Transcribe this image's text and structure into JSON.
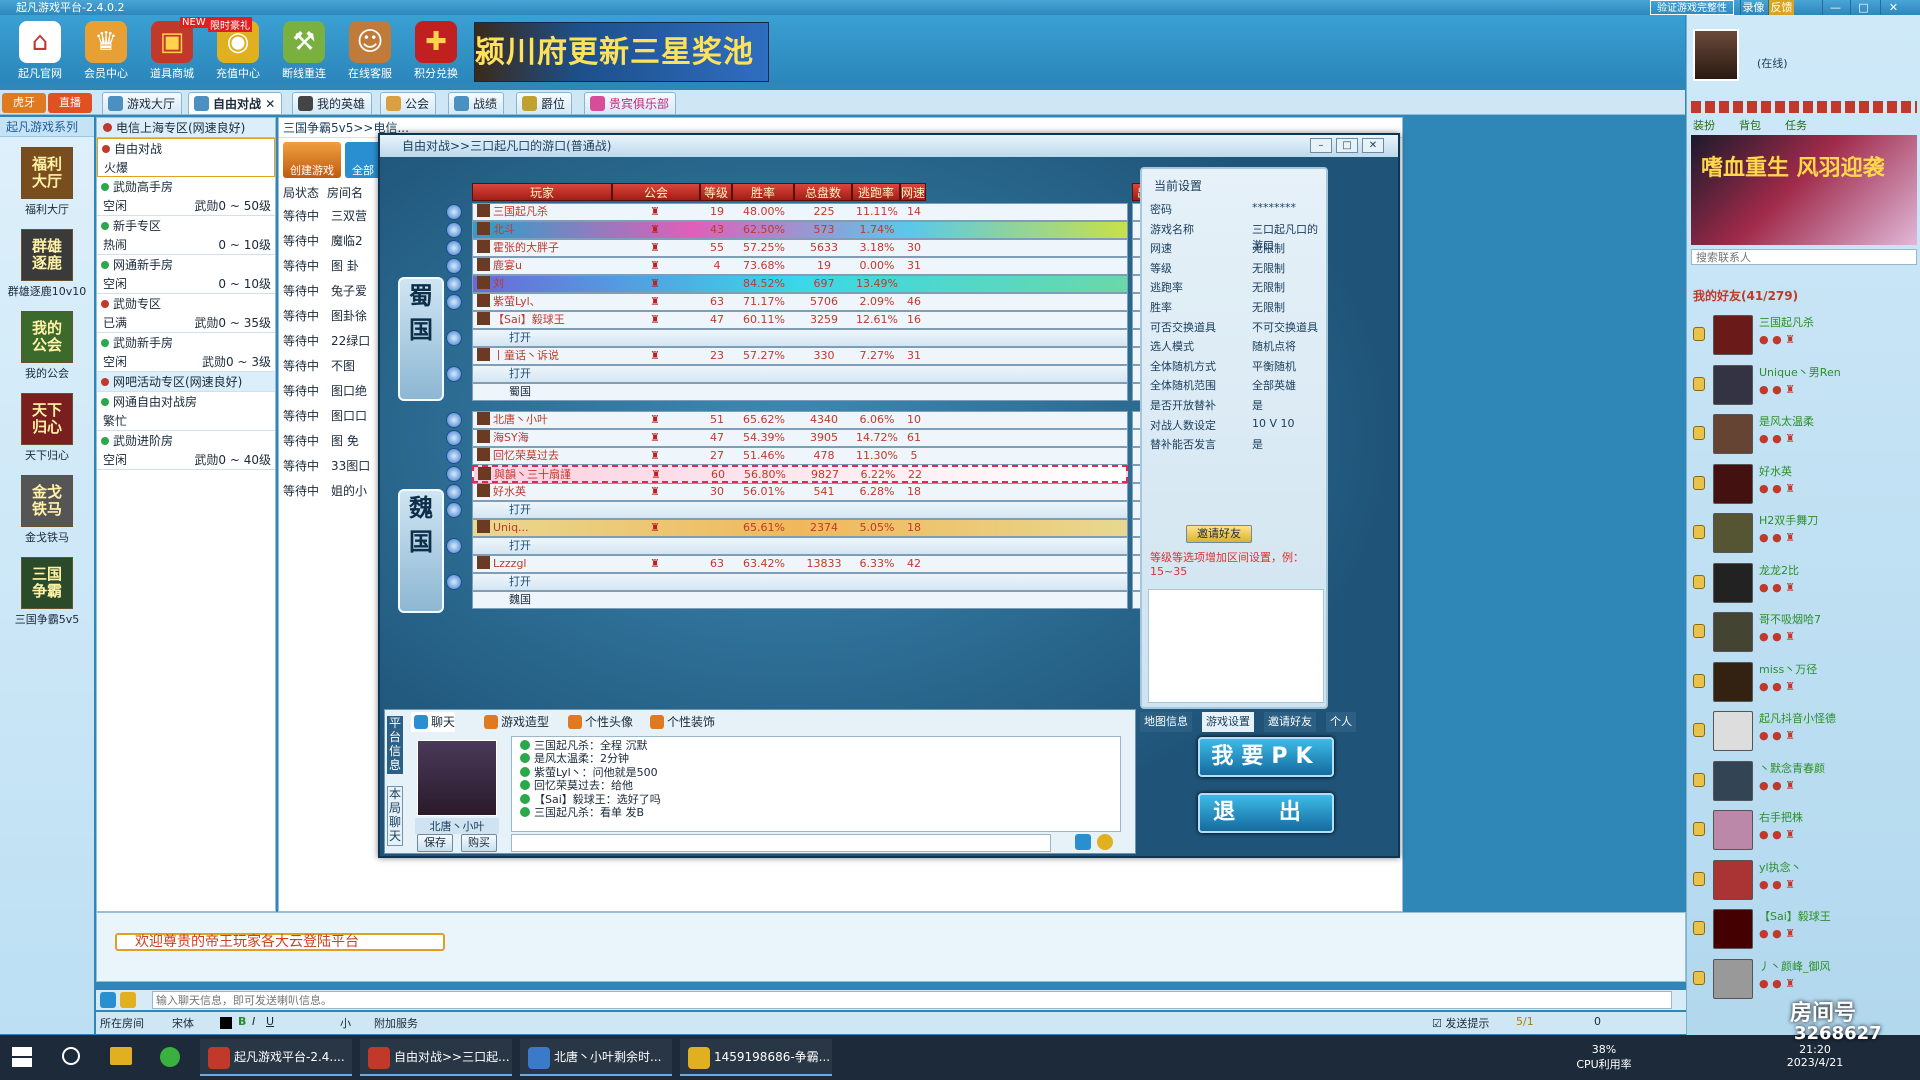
{
  "app": {
    "title": "起凡游戏平台-2.4.0.2",
    "win_btns": [
      "验证游戏完整性",
      "录像",
      "反馈",
      "—",
      "□",
      "✕"
    ]
  },
  "top_icons": [
    {
      "label": "起凡官网",
      "icon": "home-icon",
      "color": "#c0392b"
    },
    {
      "label": "会员中心",
      "icon": "crown-icon",
      "color": "#d68b1e"
    },
    {
      "label": "道具商城",
      "icon": "chest-icon",
      "color": "#c0392b",
      "badge": "NEW"
    },
    {
      "label": "充值中心",
      "icon": "gold-icon",
      "color": "#e0b020",
      "badge": "限时豪礼"
    },
    {
      "label": "断线重连",
      "icon": "broom-icon",
      "color": "#5a8a2a"
    },
    {
      "label": "在线客服",
      "icon": "service-icon",
      "color": "#b0522a"
    },
    {
      "label": "积分兑换",
      "icon": "gift-icon",
      "color": "#c02020"
    }
  ],
  "banner_text": "颍川府更新三星奖池",
  "live_tabs": [
    "虎牙",
    "直播"
  ],
  "nav_tabs": [
    {
      "label": "游戏大厅",
      "color": "#4a90c0"
    },
    {
      "label": "自由对战",
      "color": "#4a90c0",
      "active": true
    },
    {
      "label": "我的英雄",
      "color": "#444"
    },
    {
      "label": "公会",
      "color": "#d8a040"
    },
    {
      "label": "战绩",
      "color": "#4a90c0"
    },
    {
      "label": "爵位",
      "color": "#c0a030"
    },
    {
      "label": "贵宾俱乐部",
      "color": "#d84c9a"
    }
  ],
  "series_label": "起凡游戏系列",
  "games": [
    {
      "label": "福利大厅",
      "art": "福利\n大厅",
      "bg": "#7a4d1f"
    },
    {
      "label": "群雄逐鹿10v10",
      "art": "群雄\n逐鹿",
      "bg": "#3a3a3a"
    },
    {
      "label": "我的公会",
      "art": "我的\n公会",
      "bg": "#3c6a2c"
    },
    {
      "label": "天下归心",
      "art": "天下\n归心",
      "bg": "#7a1f1f"
    },
    {
      "label": "金戈铁马",
      "art": "金戈\n铁马",
      "bg": "#555"
    },
    {
      "label": "三国争霸5v5",
      "art": "三国\n争霸",
      "bg": "#2a4a2a"
    }
  ],
  "region": "电信上海专区(网速良好)",
  "rooms": [
    {
      "name": "自由对战",
      "status": "火爆",
      "right": "",
      "dot": "#c0392b",
      "selected": true
    },
    {
      "name": "武勋高手房",
      "status": "空闲",
      "right": "武勋0 ~ 50级",
      "dot": "#2aa84a"
    },
    {
      "name": "新手专区",
      "status": "热闹",
      "right": "0 ~ 10级",
      "dot": "#2aa84a"
    },
    {
      "name": "网通新手房",
      "status": "空闲",
      "right": "0 ~ 10级",
      "dot": "#2aa84a"
    },
    {
      "name": "武勋专区",
      "status": "已满",
      "right": "武勋0 ~ 35级",
      "dot": "#c0392b"
    },
    {
      "name": "武勋新手房",
      "status": "空闲",
      "right": "武勋0 ~ 3级",
      "dot": "#2aa84a"
    },
    {
      "name": "网吧活动专区(网速良好)",
      "status": "",
      "right": "",
      "dot": "#c0392b",
      "header": true
    },
    {
      "name": "网通自由对战房",
      "status": "繁忙",
      "right": "",
      "dot": "#2aa84a"
    },
    {
      "name": "武勋进阶房",
      "status": "空闲",
      "right": "武勋0 ~ 40级",
      "dot": "#2aa84a"
    }
  ],
  "room_list": {
    "crumb": "三国争霸5v5>>电信...",
    "create_label": "创建游戏",
    "all_label": "全部",
    "col_status": "局状态",
    "col_name": "房间名",
    "rows": [
      [
        "等待中",
        "三双营"
      ],
      [
        "等待中",
        "魔临2"
      ],
      [
        "等待中",
        "图 卦"
      ],
      [
        "等待中",
        "兔子爱"
      ],
      [
        "等待中",
        "图卦徐"
      ],
      [
        "等待中",
        "22绿口"
      ],
      [
        "等待中",
        "不图"
      ],
      [
        "等待中",
        "图口绝"
      ],
      [
        "等待中",
        "图口口"
      ],
      [
        "等待中",
        "图 免"
      ],
      [
        "等待中",
        "33图口"
      ],
      [
        "等待中",
        "姐的小"
      ]
    ]
  },
  "game_window": {
    "title": "自由对战>>三口起凡口的游口(普通战)",
    "headers": [
      "玩家",
      "公会",
      "等级",
      "胜率",
      "总盘数",
      "逃跑率",
      "网速",
      "出场阵容"
    ],
    "kingdom1": "蜀国",
    "kingdom2": "魏国",
    "shu_players": [
      {
        "name": "三国起凡杀",
        "lv": "19",
        "wr": "48.00%",
        "total": "225",
        "flee": "11.11%",
        "net": "14",
        "style": "",
        "fire": false
      },
      {
        "name": "北斗",
        "lv": "43",
        "wr": "62.50%",
        "total": "573",
        "flee": "1.74%",
        "net": "",
        "style": "sp1",
        "fire": false
      },
      {
        "name": "霍张的大胖子",
        "lv": "55",
        "wr": "57.25%",
        "total": "5633",
        "flee": "3.18%",
        "net": "30",
        "style": "",
        "fire": true
      },
      {
        "name": "鹿宴u",
        "lv": "4",
        "wr": "73.68%",
        "total": "19",
        "flee": "0.00%",
        "net": "31",
        "style": "",
        "fire": true
      },
      {
        "name": "刘",
        "lv": "",
        "wr": "84.52%",
        "total": "697",
        "flee": "13.49%",
        "net": "",
        "style": "sp2",
        "fire": false
      },
      {
        "name": "紫萤Lyl、",
        "lv": "63",
        "wr": "71.17%",
        "total": "5706",
        "flee": "2.09%",
        "net": "46",
        "style": "",
        "fire": false
      },
      {
        "name": "【Sai】毅球王",
        "lv": "47",
        "wr": "60.11%",
        "total": "3259",
        "flee": "12.61%",
        "net": "16",
        "style": "",
        "fire": false
      },
      {
        "name": "",
        "open": true
      },
      {
        "name": "丨童话丶诉说",
        "lv": "23",
        "wr": "57.27%",
        "total": "330",
        "flee": "7.27%",
        "net": "31",
        "style": "",
        "fire": true
      },
      {
        "name": "",
        "open": true
      }
    ],
    "wei_players": [
      {
        "name": "北唐丶小叶",
        "lv": "51",
        "wr": "65.62%",
        "total": "4340",
        "flee": "6.06%",
        "net": "10",
        "style": "",
        "fire": false
      },
      {
        "name": "海SY海",
        "lv": "47",
        "wr": "54.39%",
        "total": "3905",
        "flee": "14.72%",
        "net": "61",
        "style": "",
        "fire": true
      },
      {
        "name": "回忆荣莫过去",
        "lv": "27",
        "wr": "51.46%",
        "total": "478",
        "flee": "11.30%",
        "net": "5",
        "style": "",
        "fire": true
      },
      {
        "name": "與韻丶三十扇謹",
        "lv": "60",
        "wr": "56.80%",
        "total": "9827",
        "flee": "6.22%",
        "net": "22",
        "style": "sp4",
        "fire": true
      },
      {
        "name": "好水英",
        "lv": "30",
        "wr": "56.01%",
        "total": "541",
        "flee": "6.28%",
        "net": "18",
        "style": "",
        "fire": true
      },
      {
        "name": "",
        "open": true
      },
      {
        "name": "Uniq...",
        "lv": "",
        "wr": "65.61%",
        "total": "2374",
        "flee": "5.05%",
        "net": "18",
        "style": "sp3",
        "fire": true
      },
      {
        "name": "",
        "open": true
      },
      {
        "name": "Lzzzgl",
        "lv": "63",
        "wr": "63.42%",
        "total": "13833",
        "flee": "6.33%",
        "net": "42",
        "style": "",
        "fire": true
      },
      {
        "name": "",
        "open": true
      }
    ],
    "open_label": "打开",
    "settings_title": "当前设置",
    "settings": [
      [
        "密码",
        "********"
      ],
      [
        "游戏名称",
        "三口起凡口的游口"
      ],
      [
        "网速",
        "无限制"
      ],
      [
        "等级",
        "无限制"
      ],
      [
        "逃跑率",
        "无限制"
      ],
      [
        "胜率",
        "无限制"
      ],
      [
        "可否交换道具",
        "不可交换道具"
      ],
      [
        "选人模式",
        "随机点将"
      ],
      [
        "全体随机方式",
        "平衡随机"
      ],
      [
        "全体随机范围",
        "全部英雄"
      ],
      [
        "是否开放替补",
        "是"
      ],
      [
        "对战人数设定",
        "10 V 10"
      ],
      [
        "替补能否发言",
        "是"
      ]
    ],
    "invite_label": "邀请好友",
    "hint": "等级等选项增加区间设置，例：15~35",
    "setting_tabs": [
      "地图信息",
      "游戏设置",
      "邀请好友",
      "个人"
    ],
    "pk_label": "我要PK",
    "exit_label": "退 出",
    "chat_side": "平台信息",
    "chat_side2": "本局聊天",
    "chat_tabs": [
      "聊天",
      "游戏造型",
      "个性头像",
      "个性装饰"
    ],
    "chat_user": "北唐丶小叶",
    "save_label": "保存",
    "buy_label": "购买",
    "chat_log": [
      "三国起凡杀：全程 沉默",
      "是风太温柔：2分钟",
      "紫萤Lyl丶：问他就是500",
      "回忆荣莫过去：给他",
      "【Sai】毅球王：选好了吗",
      "三国起凡杀：看单 发B"
    ]
  },
  "welcome": "欢迎尊贵的帝王玩家各大云登陆平台",
  "chat_input_placeholder": "输入聊天信息，即可发送喇叭信息。",
  "bottom_tools": [
    "所在房间",
    "宋体",
    "小",
    "附加服务"
  ],
  "send_tip": "发送提示",
  "coins": "5/1",
  "vol": "0",
  "right_panel": {
    "status": "(在线)",
    "search_placeholder": "搜索联系人",
    "friends_header": "我的好友(41/279)",
    "links": [
      "装扮",
      "背包",
      "任务"
    ],
    "friends": [
      {
        "name": "三国起凡杀",
        "color": "#6b1a1a"
      },
      {
        "name": "Unique丶男Ren",
        "color": "#334"
      },
      {
        "name": "是风太温柔",
        "color": "#643"
      },
      {
        "name": "好水英",
        "color": "#411"
      },
      {
        "name": "H2双手舞刀",
        "color": "#553"
      },
      {
        "name": "龙龙2比",
        "color": "#222"
      },
      {
        "name": "哥不吸烟哈7",
        "color": "#443"
      },
      {
        "name": "miss丶万径",
        "color": "#321"
      },
      {
        "name": "起凡抖音小怪德",
        "color": "#ddd"
      },
      {
        "name": "丶默念青春颜",
        "color": "#345"
      },
      {
        "name": "右手把株",
        "color": "#b8a"
      },
      {
        "name": "yl执念丶",
        "color": "#a33"
      },
      {
        "name": "【Sai】毅球王",
        "color": "#400"
      },
      {
        "name": "丿丶颜峰_御风",
        "color": "#999"
      }
    ],
    "banner": "嗜血重生 风羽迎袭"
  },
  "taskbar": {
    "items": [
      {
        "label": "起凡游戏平台-2.4....",
        "color": "#c0392b"
      },
      {
        "label": "自由对战>>三口起...",
        "color": "#c0392b"
      },
      {
        "label": "北唐丶小叶剩余时...",
        "color": "#3a7ac8"
      },
      {
        "label": "1459198686-争霸...",
        "color": "#e0b020"
      }
    ],
    "cpu": "38%",
    "cpu_label": "CPU利用率",
    "time": "21:20",
    "date": "2023/4/21",
    "watermark": "房间号",
    "room_no": "3268627"
  }
}
